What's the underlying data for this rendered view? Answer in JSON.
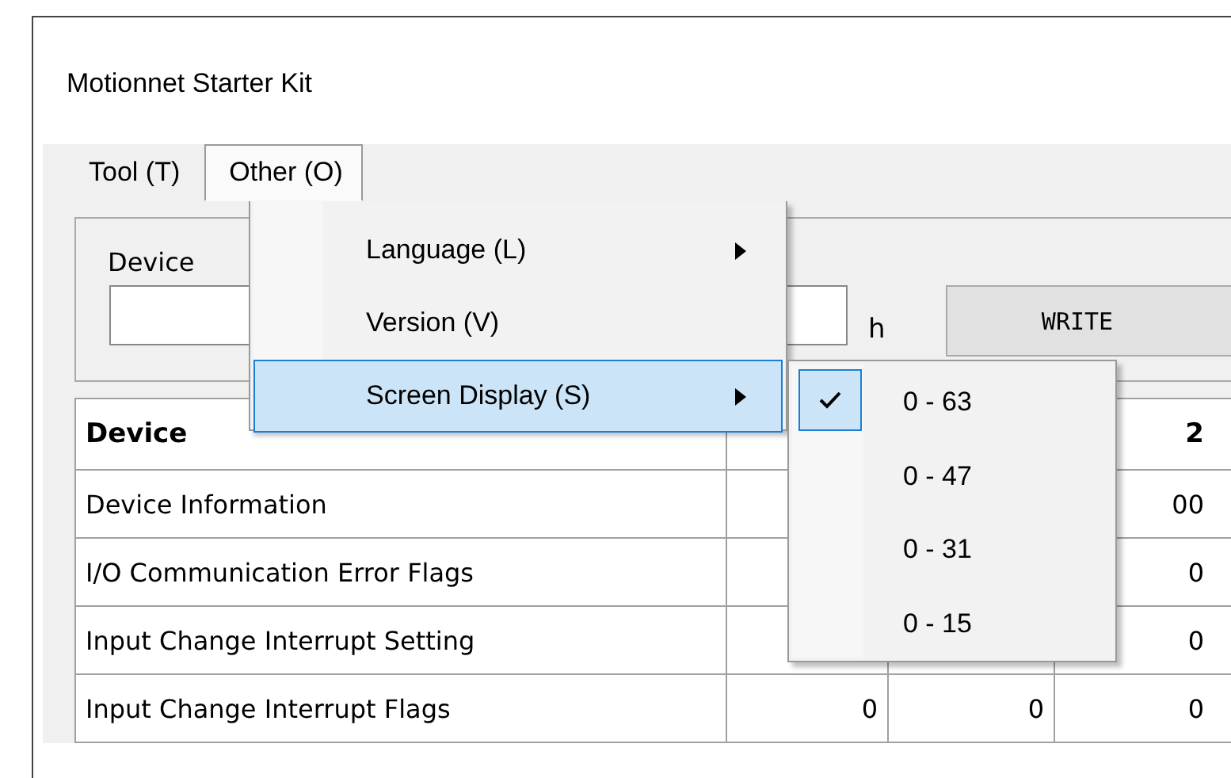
{
  "window": {
    "title": "Motionnet Starter Kit"
  },
  "menu_bar": [
    {
      "label": "Tool (T)",
      "selected": false
    },
    {
      "label": "Other (O)",
      "selected": true
    }
  ],
  "device_group": {
    "label": "Device",
    "unit": "h",
    "write_button": "WRITE"
  },
  "table": {
    "header": {
      "column_1": "Device",
      "column_4": "2"
    },
    "rows": [
      {
        "column_1": "Device Information",
        "column_4": "00"
      },
      {
        "column_1": "I/O Communication Error Flags",
        "column_4": "0"
      },
      {
        "column_1": "Input Change Interrupt Setting",
        "column_4": "0"
      },
      {
        "column_1": "Input Change Interrupt Flags",
        "column_2": "0",
        "column_3": "0",
        "column_4": "0"
      }
    ]
  },
  "menu": {
    "items": [
      {
        "label": "Language (L)",
        "submenu": true,
        "selected": false
      },
      {
        "label": "Version (V)",
        "submenu": false,
        "selected": false
      },
      {
        "label": "Screen Display (S)",
        "submenu": true,
        "selected": true
      }
    ]
  },
  "submenu": {
    "items": [
      {
        "label": "0 - 63",
        "checked": true
      },
      {
        "label": "0 - 47",
        "checked": false
      },
      {
        "label": "0 - 31",
        "checked": false
      },
      {
        "label": "0 - 15",
        "checked": false
      }
    ]
  }
}
